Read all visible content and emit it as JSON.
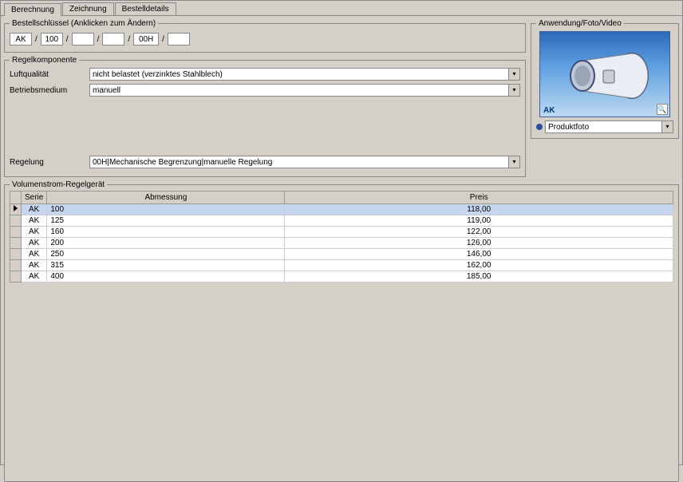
{
  "tabs": {
    "t0": "Berechnung",
    "t1": "Zeichnung",
    "t2": "Bestelldetails"
  },
  "order_key": {
    "legend": "Bestellschlüssel (Anklicken zum Ändern)",
    "p0": "AK",
    "p1": "100",
    "p2": "",
    "p3": "",
    "p4": "00H",
    "p5": ""
  },
  "regel": {
    "legend": "Regelkomponente",
    "luft_label": "Luftqualität",
    "luft_value": "nicht belastet (verzinktes Stahlblech)",
    "betrieb_label": "Betriebsmedium",
    "betrieb_value": "manuell",
    "regelung_label": "Regelung",
    "regelung_value": "00H|Mechanische Begrenzung|manuelle Regelung"
  },
  "media": {
    "legend": "Anwendung/Foto/Video",
    "label": "AK",
    "combo_value": "Produktfoto"
  },
  "table": {
    "legend": "Volumenstrom-Regelgerät",
    "col_serie": "Serie",
    "col_abm": "Abmessung",
    "col_preis": "Preis",
    "rows": [
      {
        "serie": "AK",
        "abm": "100",
        "preis": "118,00"
      },
      {
        "serie": "AK",
        "abm": "125",
        "preis": "119,00"
      },
      {
        "serie": "AK",
        "abm": "160",
        "preis": "122,00"
      },
      {
        "serie": "AK",
        "abm": "200",
        "preis": "126,00"
      },
      {
        "serie": "AK",
        "abm": "250",
        "preis": "146,00"
      },
      {
        "serie": "AK",
        "abm": "315",
        "preis": "162,00"
      },
      {
        "serie": "AK",
        "abm": "400",
        "preis": "185,00"
      }
    ]
  }
}
